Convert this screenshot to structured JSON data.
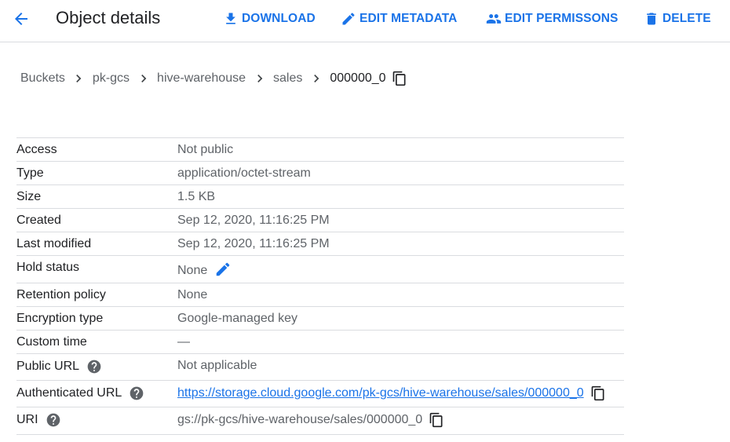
{
  "header": {
    "title": "Object details",
    "actions": {
      "download": "DOWNLOAD",
      "edit_metadata": "EDIT METADATA",
      "edit_permissions": "EDIT PERMISSONS",
      "delete": "DELETE"
    }
  },
  "breadcrumb": {
    "items": [
      "Buckets",
      "pk-gcs",
      "hive-warehouse",
      "sales",
      "000000_0"
    ]
  },
  "details": {
    "access": {
      "label": "Access",
      "value": "Not public"
    },
    "type": {
      "label": "Type",
      "value": "application/octet-stream"
    },
    "size": {
      "label": "Size",
      "value": "1.5 KB"
    },
    "created": {
      "label": "Created",
      "value": "Sep 12, 2020, 11:16:25 PM"
    },
    "last_modified": {
      "label": "Last modified",
      "value": "Sep 12, 2020, 11:16:25 PM"
    },
    "hold_status": {
      "label": "Hold status",
      "value": "None"
    },
    "retention_policy": {
      "label": "Retention policy",
      "value": "None"
    },
    "encryption_type": {
      "label": "Encryption type",
      "value": "Google-managed key"
    },
    "custom_time": {
      "label": "Custom time",
      "value": "—"
    },
    "public_url": {
      "label": "Public URL",
      "value": "Not applicable"
    },
    "authenticated_url": {
      "label": "Authenticated URL",
      "value": "https://storage.cloud.google.com/pk-gcs/hive-warehouse/sales/000000_0"
    },
    "uri": {
      "label": "URI",
      "value": "gs://pk-gcs/hive-warehouse/sales/000000_0"
    }
  },
  "icons": {
    "back": "arrow-back-icon",
    "download": "download-icon",
    "edit_metadata": "pencil-icon",
    "edit_permissions": "people-icon",
    "delete": "trash-icon",
    "breadcrumb_separator": "chevron-right-icon",
    "copy": "copy-icon",
    "help": "help-circle-icon",
    "edit": "pencil-icon"
  },
  "colors": {
    "accent": "#1a73e8",
    "text_primary": "#202124",
    "text_secondary": "#5f6368",
    "divider": "#dadce0"
  }
}
